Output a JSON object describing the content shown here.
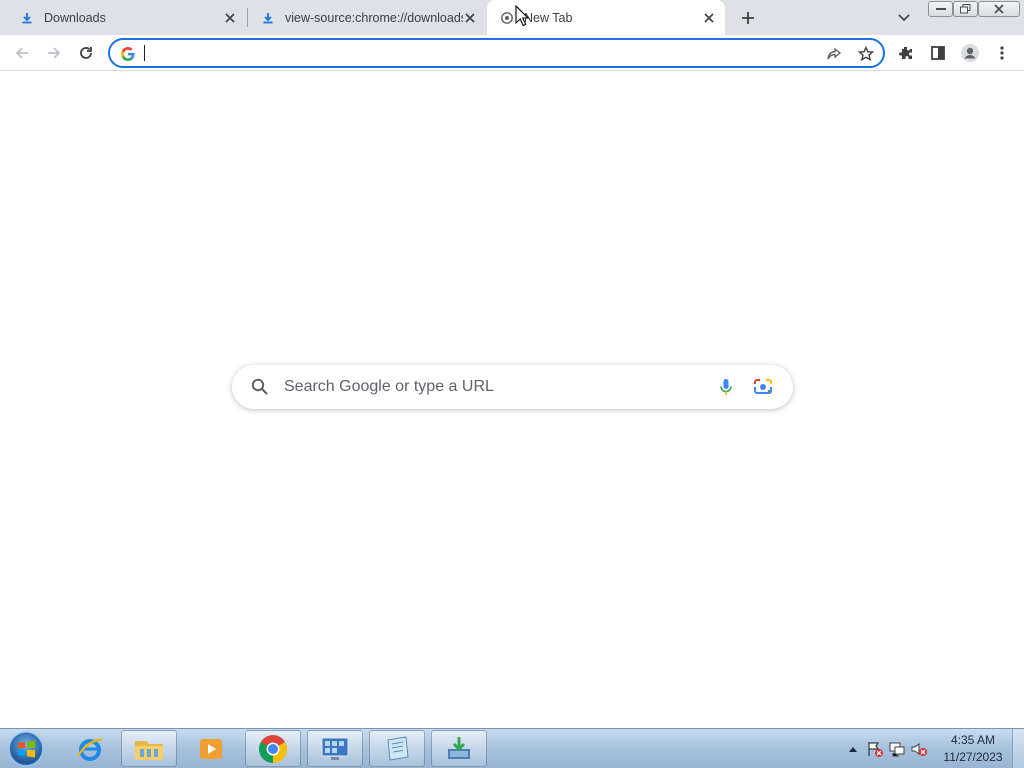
{
  "tabs": [
    {
      "title": "Downloads",
      "icon": "download-icon",
      "active": false
    },
    {
      "title": "view-source:chrome://downloads",
      "icon": "download-icon",
      "active": false
    },
    {
      "title": "New Tab",
      "icon": "chrome-icon",
      "active": true
    }
  ],
  "omnibox": {
    "value": "",
    "search_engine_icon": "google-g-icon"
  },
  "ntp": {
    "search_placeholder": "Search Google or type a URL"
  },
  "clock": {
    "time": "4:35 AM",
    "date": "11/27/2023"
  },
  "taskbar": {
    "apps": [
      "internet-explorer-icon",
      "file-explorer-icon",
      "media-player-icon",
      "chrome-icon",
      "control-panel-icon",
      "notepad-icon",
      "download-manager-icon"
    ]
  },
  "colors": {
    "accent": "#1a73e8",
    "tabstrip": "#dee1e6",
    "taskbar": "#a9c3de"
  }
}
